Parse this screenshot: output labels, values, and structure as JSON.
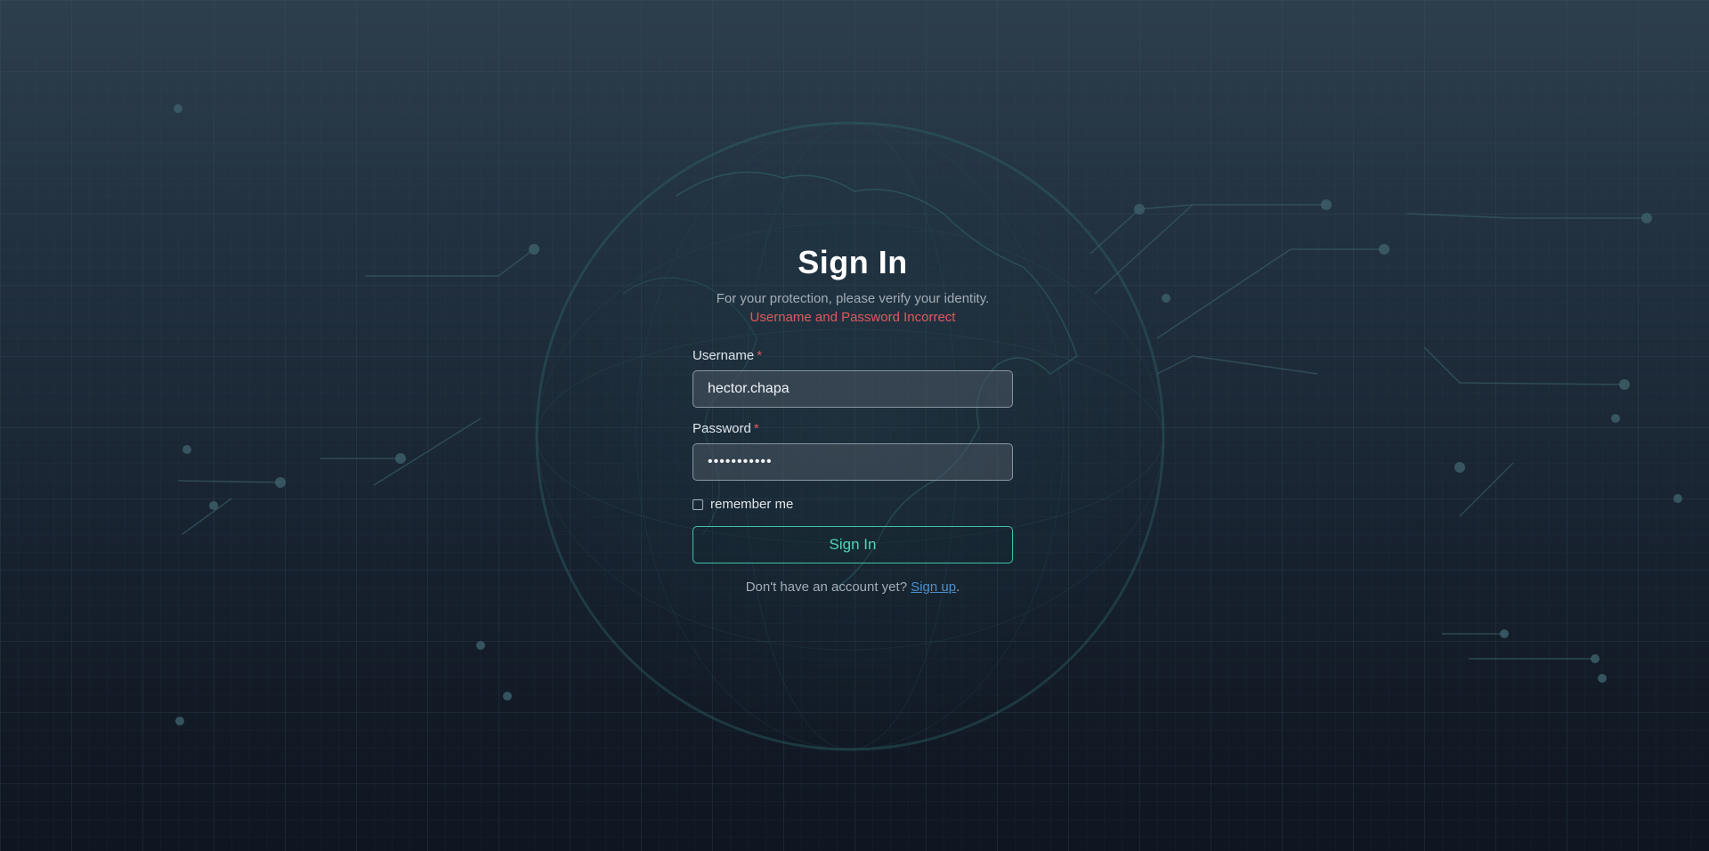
{
  "page": {
    "title": "Sign In",
    "subtitle": "For your protection, please verify your identity.",
    "error": "Username and Password Incorrect"
  },
  "form": {
    "username_label": "Username",
    "username_value": "hector.chapa",
    "password_label": "Password",
    "password_value": "•••••••••••",
    "required_marker": "*",
    "remember_label": "remember me",
    "remember_checked": false,
    "submit_label": "Sign In"
  },
  "footer": {
    "prompt": "Don't have an account yet?",
    "link_label": "Sign up",
    "suffix": "."
  },
  "colors": {
    "accent": "#3fc5a8",
    "error": "#e0595d",
    "link": "#4b8fc9",
    "background_top": "#2d3e4d",
    "background_bottom": "#0f1621"
  }
}
